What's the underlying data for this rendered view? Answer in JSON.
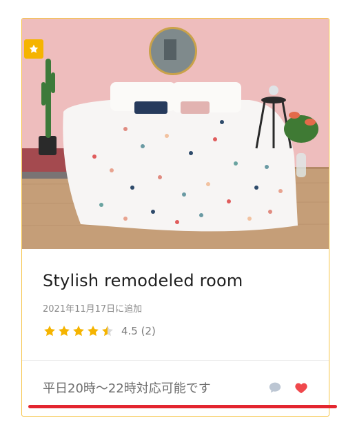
{
  "listing": {
    "title": "Stylish remodeled room",
    "added_date": "2021年11月17日に追加",
    "rating": {
      "value": 4.5,
      "stars_max": 5,
      "label": "4.5 (2)"
    },
    "footer_note": "平日20時～22時対応可能です",
    "badge_icon": "star-icon",
    "image_alt": "bedroom-photo"
  },
  "colors": {
    "accent": "#f5b400",
    "border": "#f6c343",
    "heart": "#f0484c",
    "comment": "#bcc6d3",
    "underline": "#e3262f"
  }
}
